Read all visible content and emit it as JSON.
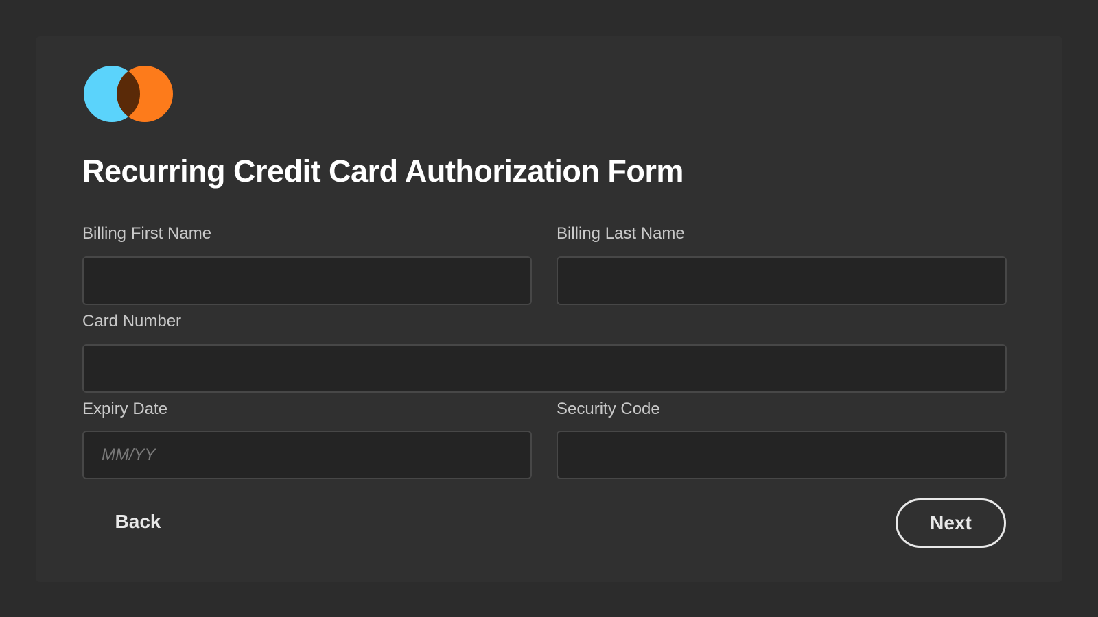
{
  "colors": {
    "logo_left": "#5bd3fb",
    "logo_right": "#fd7b1b",
    "logo_overlap": "#5a2a08",
    "background": "#2c2c2c",
    "card": "#303030",
    "input_bg": "#242424"
  },
  "logo": {
    "icon": "two-overlapping-circles-logo"
  },
  "form": {
    "title": "Recurring Credit Card Authorization Form",
    "fields": {
      "first_name": {
        "label": "Billing First Name",
        "value": "",
        "placeholder": ""
      },
      "last_name": {
        "label": "Billing Last Name",
        "value": "",
        "placeholder": ""
      },
      "card_number": {
        "label": "Card Number",
        "value": "",
        "placeholder": ""
      },
      "expiry": {
        "label": "Expiry Date",
        "value": "",
        "placeholder": "MM/YY"
      },
      "security_code": {
        "label": "Security Code",
        "value": "",
        "placeholder": ""
      }
    },
    "buttons": {
      "back": "Back",
      "next": "Next"
    }
  }
}
